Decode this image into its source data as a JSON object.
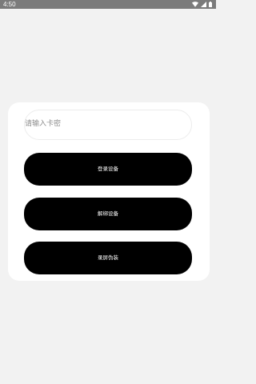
{
  "status_bar": {
    "time": "4:50",
    "icons": [
      "wifi-icon",
      "signal-icon",
      "battery-icon"
    ]
  },
  "card_key_input": {
    "placeholder": "请输入卡密"
  },
  "buttons": {
    "login_device": "登录设备",
    "unbind_device": "解绑设备",
    "screen_record_disguise": "录屏伪装"
  }
}
